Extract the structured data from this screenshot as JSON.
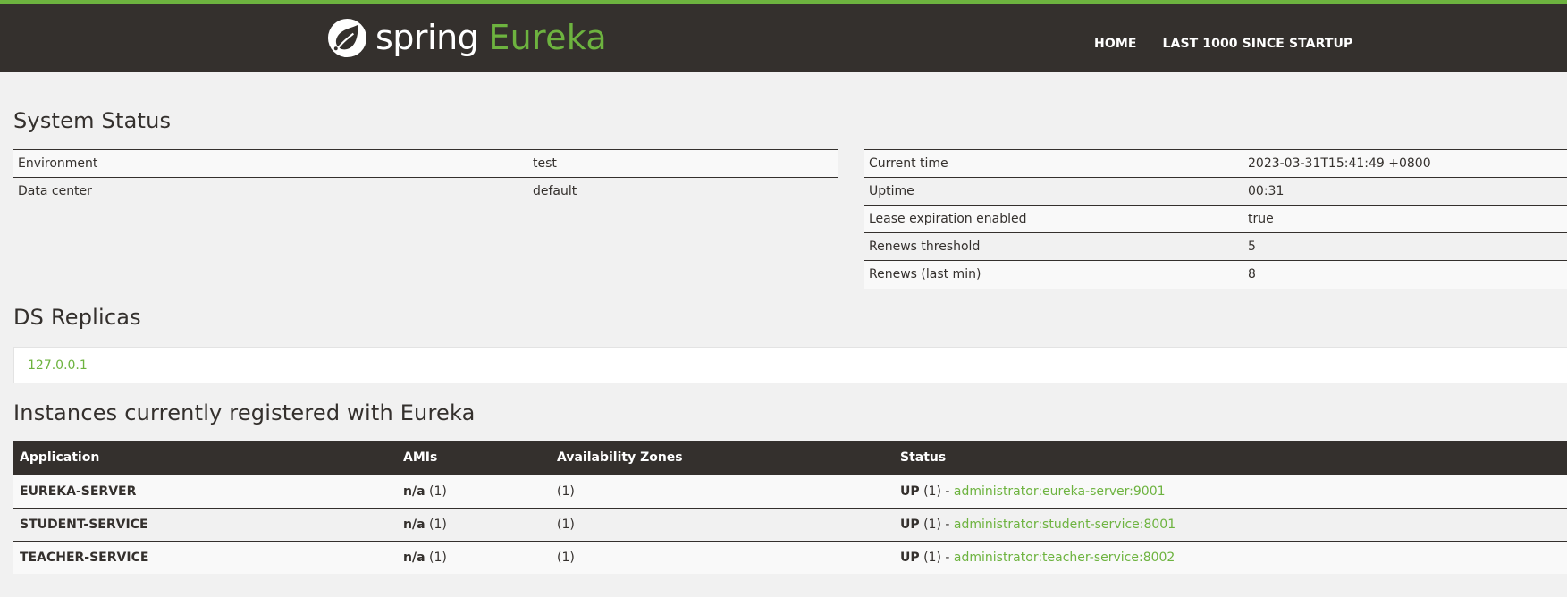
{
  "header": {
    "logo_word": "spring",
    "product": "Eureka",
    "nav": [
      {
        "label": "HOME"
      },
      {
        "label": "LAST 1000 SINCE STARTUP"
      }
    ]
  },
  "system_status": {
    "title": "System Status",
    "left": [
      {
        "key": "Environment",
        "value": "test"
      },
      {
        "key": "Data center",
        "value": "default"
      }
    ],
    "right": [
      {
        "key": "Current time",
        "value": "2023-03-31T15:41:49 +0800"
      },
      {
        "key": "Uptime",
        "value": "00:31"
      },
      {
        "key": "Lease expiration enabled",
        "value": "true"
      },
      {
        "key": "Renews threshold",
        "value": "5"
      },
      {
        "key": "Renews (last min)",
        "value": "8"
      }
    ]
  },
  "replicas": {
    "title": "DS Replicas",
    "items": [
      "127.0.0.1"
    ]
  },
  "instances": {
    "title": "Instances currently registered with Eureka",
    "columns": [
      "Application",
      "AMIs",
      "Availability Zones",
      "Status"
    ],
    "rows": [
      {
        "app": "EUREKA-SERVER",
        "ami_bold": "n/a",
        "ami_count": "(1)",
        "zones": "(1)",
        "status_bold": "UP",
        "status_count": "(1) -",
        "instance": "administrator:eureka-server:9001"
      },
      {
        "app": "STUDENT-SERVICE",
        "ami_bold": "n/a",
        "ami_count": "(1)",
        "zones": "(1)",
        "status_bold": "UP",
        "status_count": "(1) -",
        "instance": "administrator:student-service:8001"
      },
      {
        "app": "TEACHER-SERVICE",
        "ami_bold": "n/a",
        "ami_count": "(1)",
        "zones": "(1)",
        "status_bold": "UP",
        "status_count": "(1) -",
        "instance": "administrator:teacher-service:8002"
      }
    ]
  },
  "colors": {
    "brand_green": "#6db33f",
    "header_bg": "#34302d"
  }
}
